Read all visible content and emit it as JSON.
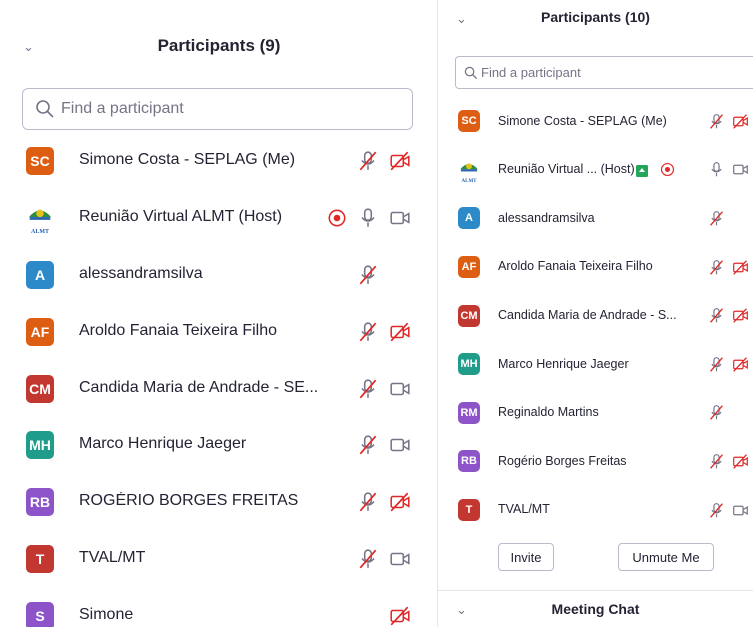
{
  "left_panel": {
    "title": "Participants (9)",
    "search": {
      "placeholder": "Find a participant"
    },
    "participants": [
      {
        "initials": "SC",
        "name": "Simone Costa - SEPLAG (Me)",
        "color": "#dd5e12",
        "mic": "muted",
        "video": "off"
      },
      {
        "initials": "",
        "name": "Reunião Virtual ALMT (Host)",
        "logo_text": "ALMT",
        "recording": true,
        "mic": "on",
        "video": "on"
      },
      {
        "initials": "A",
        "name": "alessandramsilva",
        "color": "#2d8ac8",
        "mic": "muted",
        "video": "none"
      },
      {
        "initials": "AF",
        "name": "Aroldo Fanaia Teixeira Filho",
        "color": "#dd5e12",
        "mic": "muted",
        "video": "off"
      },
      {
        "initials": "CM",
        "name": "Candida Maria de Andrade - SE...",
        "color": "#c2372f",
        "mic": "muted",
        "video": "on"
      },
      {
        "initials": "MH",
        "name": "Marco Henrique Jaeger",
        "color": "#1f9c8a",
        "mic": "muted",
        "video": "on"
      },
      {
        "initials": "RB",
        "name": "ROGÉRIO BORGES FREITAS",
        "color": "#8c54c8",
        "mic": "muted",
        "video": "off"
      },
      {
        "initials": "T",
        "name": "TVAL/MT",
        "color": "#c2372f",
        "mic": "muted",
        "video": "on"
      },
      {
        "initials": "S",
        "name": "Simone",
        "color": "#8c54c8",
        "mic": "none",
        "video": "off"
      }
    ]
  },
  "right_panel": {
    "title": "Participants (10)",
    "search": {
      "placeholder": "Find a participant"
    },
    "participants": [
      {
        "initials": "SC",
        "name": "Simone Costa - SEPLAG (Me)",
        "color": "#dd5e12",
        "mic": "muted",
        "video": "off"
      },
      {
        "initials": "",
        "name": "Reunião Virtual ... (Host)",
        "logo_text": "ALMT",
        "chat_badge": true,
        "recording": true,
        "mic": "on",
        "video": "on"
      },
      {
        "initials": "A",
        "name": "alessandramsilva",
        "color": "#2d8ac8",
        "mic": "muted",
        "video": "none"
      },
      {
        "initials": "AF",
        "name": "Aroldo Fanaia Teixeira Filho",
        "color": "#dd5e12",
        "mic": "muted",
        "video": "off"
      },
      {
        "initials": "CM",
        "name": "Candida Maria de Andrade - S...",
        "color": "#c2372f",
        "mic": "muted",
        "video": "off"
      },
      {
        "initials": "MH",
        "name": "Marco Henrique Jaeger",
        "color": "#1f9c8a",
        "mic": "muted",
        "video": "off"
      },
      {
        "initials": "RM",
        "name": "Reginaldo Martins",
        "color": "#8c54c8",
        "mic": "muted",
        "video": "none"
      },
      {
        "initials": "RB",
        "name": "Rogério Borges Freitas",
        "color": "#8c54c8",
        "mic": "muted",
        "video": "off"
      },
      {
        "initials": "T",
        "name": "TVAL/MT",
        "color": "#c2372f",
        "mic": "muted",
        "video": "on"
      }
    ],
    "buttons": {
      "invite": "Invite",
      "unmute": "Unmute Me"
    },
    "chat": {
      "title": "Meeting Chat"
    }
  },
  "icons": {
    "collapse": "chevron-down-icon",
    "search": "search-icon",
    "mic_muted": "mic-muted-icon",
    "mic_on": "mic-icon",
    "video_off": "video-off-icon",
    "video_on": "video-icon",
    "recording": "recording-icon",
    "chat_badge": "chat-badge-icon"
  },
  "colors": {
    "muted_red": "#e02828",
    "icon_gray": "#747487",
    "recording_red": "#e02828",
    "badge_green": "#23a659",
    "text": "#232333"
  }
}
